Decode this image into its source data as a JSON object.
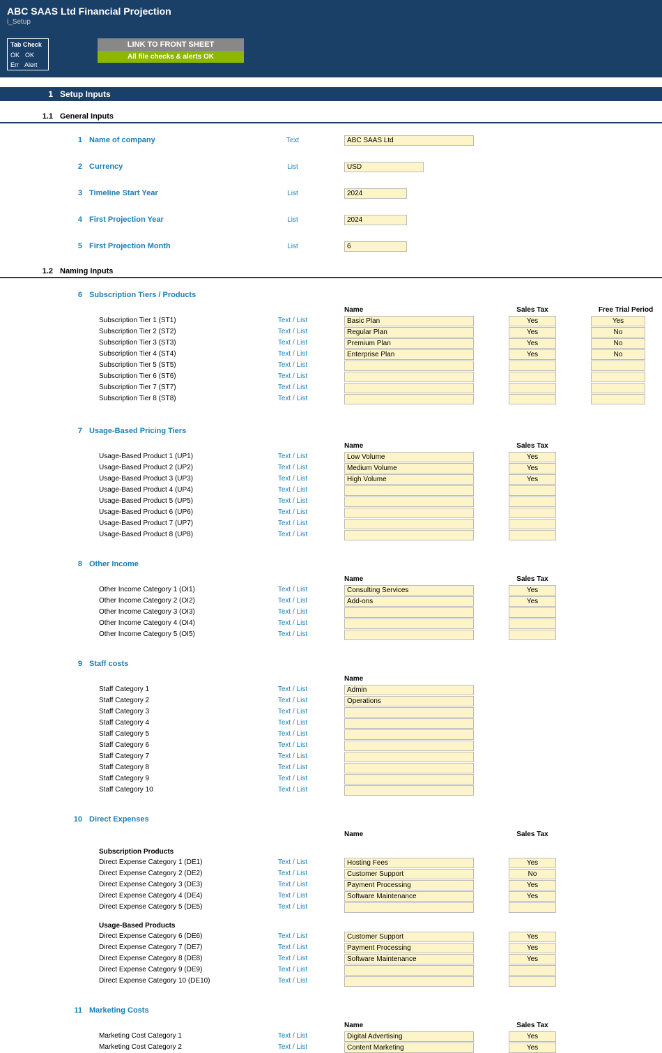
{
  "header": {
    "title": "ABC SAAS Ltd Financial Projection",
    "sub": "i_Setup"
  },
  "tabcheck": {
    "hdr": "Tab Check",
    "r1a": "OK",
    "r1b": "OK",
    "r2a": "Err",
    "r2b": "Alert"
  },
  "linkbtn": {
    "t1": "LINK TO FRONT SHEET",
    "t2": "All file checks & alerts OK"
  },
  "s1": {
    "num": "1",
    "title": "Setup Inputs"
  },
  "s11": {
    "num": "1.1",
    "title": "General Inputs"
  },
  "g": {
    "1": {
      "n": "1",
      "label": "Name of company",
      "type": "Text",
      "val": "ABC SAAS Ltd"
    },
    "2": {
      "n": "2",
      "label": "Currency",
      "type": "List",
      "val": "USD"
    },
    "3": {
      "n": "3",
      "label": "Timeline Start Year",
      "type": "List",
      "val": "2024"
    },
    "4": {
      "n": "4",
      "label": "First Projection Year",
      "type": "List",
      "val": "2024"
    },
    "5": {
      "n": "5",
      "label": "First Projection Month",
      "type": "List",
      "val": "6"
    }
  },
  "s12": {
    "num": "1.2",
    "title": "Naming Inputs"
  },
  "h": {
    "name": "Name",
    "tax": "Sales Tax",
    "trial": "Free Trial Period"
  },
  "tiers": {
    "n": "6",
    "label": "Subscription Tiers / Products",
    "rows": [
      {
        "label": "Subscription Tier 1 (ST1)",
        "type": "Text / List",
        "name": "Basic Plan",
        "tax": "Yes",
        "trial": "Yes"
      },
      {
        "label": "Subscription Tier 2 (ST2)",
        "type": "Text / List",
        "name": "Regular Plan",
        "tax": "Yes",
        "trial": "No"
      },
      {
        "label": "Subscription Tier 3 (ST3)",
        "type": "Text / List",
        "name": "Premium Plan",
        "tax": "Yes",
        "trial": "No"
      },
      {
        "label": "Subscription Tier 4 (ST4)",
        "type": "Text / List",
        "name": "Enterprise Plan",
        "tax": "Yes",
        "trial": "No"
      },
      {
        "label": "Subscription Tier 5 (ST5)",
        "type": "Text / List",
        "name": "",
        "tax": "",
        "trial": ""
      },
      {
        "label": "Subscription Tier 6 (ST6)",
        "type": "Text / List",
        "name": "",
        "tax": "",
        "trial": ""
      },
      {
        "label": "Subscription Tier 7 (ST7)",
        "type": "Text / List",
        "name": "",
        "tax": "",
        "trial": ""
      },
      {
        "label": "Subscription Tier 8 (ST8)",
        "type": "Text / List",
        "name": "",
        "tax": "",
        "trial": ""
      }
    ]
  },
  "usage": {
    "n": "7",
    "label": "Usage-Based Pricing Tiers",
    "rows": [
      {
        "label": "Usage-Based Product 1 (UP1)",
        "type": "Text / List",
        "name": "Low Volume",
        "tax": "Yes"
      },
      {
        "label": "Usage-Based Product 2 (UP2)",
        "type": "Text / List",
        "name": "Medium Volume",
        "tax": "Yes"
      },
      {
        "label": "Usage-Based Product 3 (UP3)",
        "type": "Text / List",
        "name": "High Volume",
        "tax": "Yes"
      },
      {
        "label": "Usage-Based Product 4 (UP4)",
        "type": "Text / List",
        "name": "",
        "tax": ""
      },
      {
        "label": "Usage-Based Product 5 (UP5)",
        "type": "Text / List",
        "name": "",
        "tax": ""
      },
      {
        "label": "Usage-Based Product 6 (UP6)",
        "type": "Text / List",
        "name": "",
        "tax": ""
      },
      {
        "label": "Usage-Based Product 7 (UP7)",
        "type": "Text / List",
        "name": "",
        "tax": ""
      },
      {
        "label": "Usage-Based Product 8 (UP8)",
        "type": "Text / List",
        "name": "",
        "tax": ""
      }
    ]
  },
  "other": {
    "n": "8",
    "label": "Other Income",
    "rows": [
      {
        "label": "Other Income Category 1 (OI1)",
        "type": "Text / List",
        "name": "Consulting Services",
        "tax": "Yes"
      },
      {
        "label": "Other Income Category 2 (OI2)",
        "type": "Text / List",
        "name": "Add-ons",
        "tax": "Yes"
      },
      {
        "label": "Other Income Category 3 (OI3)",
        "type": "Text / List",
        "name": "",
        "tax": ""
      },
      {
        "label": "Other Income Category 4 (OI4)",
        "type": "Text / List",
        "name": "",
        "tax": ""
      },
      {
        "label": "Other Income Category 5 (OI5)",
        "type": "Text / List",
        "name": "",
        "tax": ""
      }
    ]
  },
  "staff": {
    "n": "9",
    "label": "Staff costs",
    "rows": [
      {
        "label": "Staff Category 1",
        "type": "Text / List",
        "name": "Admin"
      },
      {
        "label": "Staff Category 2",
        "type": "Text / List",
        "name": "Operations"
      },
      {
        "label": "Staff Category 3",
        "type": "Text / List",
        "name": ""
      },
      {
        "label": "Staff Category 4",
        "type": "Text / List",
        "name": ""
      },
      {
        "label": "Staff Category 5",
        "type": "Text / List",
        "name": ""
      },
      {
        "label": "Staff Category 6",
        "type": "Text / List",
        "name": ""
      },
      {
        "label": "Staff Category 7",
        "type": "Text / List",
        "name": ""
      },
      {
        "label": "Staff Category 8",
        "type": "Text / List",
        "name": ""
      },
      {
        "label": "Staff Category 9",
        "type": "Text / List",
        "name": ""
      },
      {
        "label": "Staff Category 10",
        "type": "Text / List",
        "name": ""
      }
    ]
  },
  "direct": {
    "n": "10",
    "label": "Direct Expenses",
    "sub1": "Subscription Products",
    "rows1": [
      {
        "label": "Direct Expense Category 1 (DE1)",
        "type": "Text / List",
        "name": "Hosting Fees",
        "tax": "Yes"
      },
      {
        "label": "Direct Expense Category 2 (DE2)",
        "type": "Text / List",
        "name": "Customer Support",
        "tax": "No"
      },
      {
        "label": "Direct Expense Category 3 (DE3)",
        "type": "Text / List",
        "name": "Payment Processing",
        "tax": "Yes"
      },
      {
        "label": "Direct Expense Category 4 (DE4)",
        "type": "Text / List",
        "name": "Software Maintenance",
        "tax": "Yes"
      },
      {
        "label": "Direct Expense Category 5 (DE5)",
        "type": "Text / List",
        "name": "",
        "tax": ""
      }
    ],
    "sub2": "Usage-Based Products",
    "rows2": [
      {
        "label": "Direct Expense Category 6 (DE6)",
        "type": "Text / List",
        "name": "Customer Support",
        "tax": "Yes"
      },
      {
        "label": "Direct Expense Category 7 (DE7)",
        "type": "Text / List",
        "name": "Payment Processing",
        "tax": "Yes"
      },
      {
        "label": "Direct Expense Category 8 (DE8)",
        "type": "Text / List",
        "name": "Software Maintenance",
        "tax": "Yes"
      },
      {
        "label": "Direct Expense Category 9 (DE9)",
        "type": "Text / List",
        "name": "",
        "tax": ""
      },
      {
        "label": "Direct Expense Category 10 (DE10)",
        "type": "Text / List",
        "name": "",
        "tax": ""
      }
    ]
  },
  "mkt": {
    "n": "11",
    "label": "Marketing Costs",
    "rows": [
      {
        "label": "Marketing Cost Category 1",
        "type": "Text / List",
        "name": "Digital Advertising",
        "tax": "Yes"
      },
      {
        "label": "Marketing Cost Category 2",
        "type": "Text / List",
        "name": "Content Marketing",
        "tax": "Yes"
      }
    ]
  }
}
